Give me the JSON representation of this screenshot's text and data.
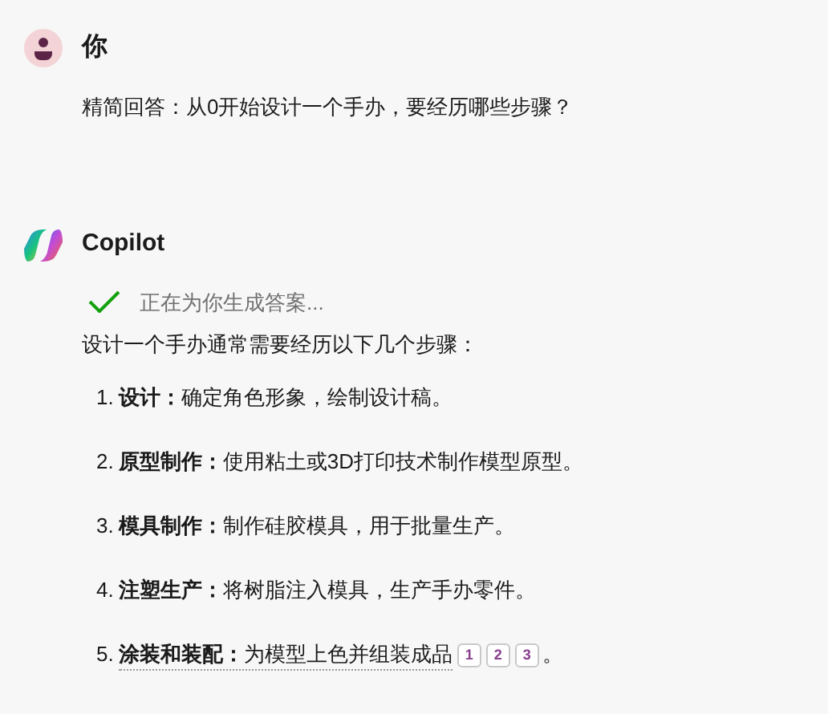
{
  "user": {
    "name": "你",
    "message": "精简回答：从0开始设计一个手办，要经历哪些步骤？"
  },
  "assistant": {
    "name": "Copilot",
    "status": "正在为你生成答案...",
    "status_done": true,
    "intro": "设计一个手办通常需要经历以下几个步骤：",
    "steps": [
      {
        "number": "1.",
        "title": "设计：",
        "text": "确定角色形象，绘制设计稿。",
        "underlined": false
      },
      {
        "number": "2.",
        "title": "原型制作：",
        "text": "使用粘土或3D打印技术制作模型原型。",
        "underlined": false
      },
      {
        "number": "3.",
        "title": "模具制作：",
        "text": "制作硅胶模具，用于批量生产。",
        "underlined": false
      },
      {
        "number": "4.",
        "title": "注塑生产：",
        "text": "将树脂注入模具，生产手办零件。",
        "underlined": false
      },
      {
        "number": "5.",
        "title": "涂装和装配：",
        "text": "为模型上色并组装成品",
        "underlined": true,
        "citations": [
          "1",
          "2",
          "3"
        ],
        "tail": "。"
      }
    ]
  }
}
